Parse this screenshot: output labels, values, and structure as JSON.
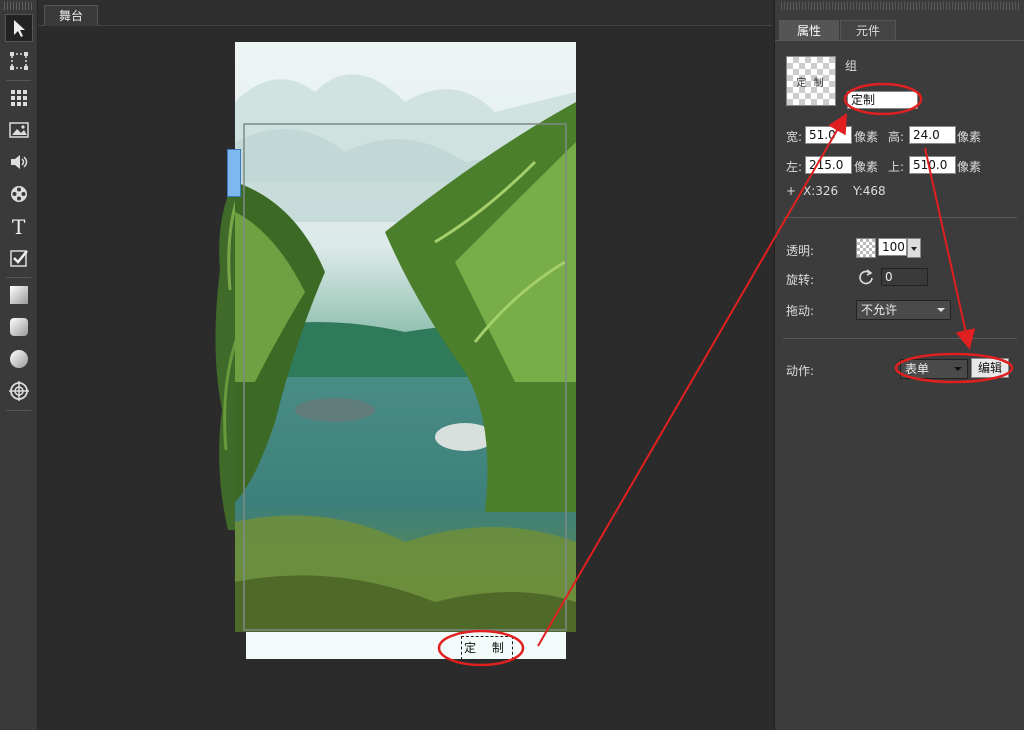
{
  "stage": {
    "tab_label": "舞台"
  },
  "toolbar": {
    "tools": [
      "select",
      "transform",
      "grid",
      "image",
      "audio",
      "video",
      "text",
      "checkbox",
      "rect",
      "rounded-rect",
      "circle",
      "target"
    ]
  },
  "scene": {
    "button_label": "定 制"
  },
  "panel": {
    "tabs": [
      {
        "label": "属性"
      },
      {
        "label": "元件"
      }
    ],
    "group_label": "组",
    "thumb_label": "定 制",
    "name_value": "定制",
    "width_label": "宽:",
    "width_value": "51.0",
    "height_label": "高:",
    "height_value": "24.0",
    "unit": "像素",
    "left_label": "左:",
    "left_value": "215.0",
    "top_label": "上:",
    "top_value": "510.0",
    "coord_plus": "+",
    "coord_x": "X:326",
    "coord_y": "Y:468",
    "opacity_label": "透明:",
    "opacity_value": "100",
    "rotate_label": "旋转:",
    "rotate_value": "0",
    "drag_label": "拖动:",
    "drag_value": "不允许",
    "action_label": "动作:",
    "action_value": "表单",
    "edit_button": "编辑"
  },
  "colors": {
    "annotation": "#e02020",
    "panel_bg": "#3c3c3c",
    "stage_bg": "#2b2b2b"
  }
}
